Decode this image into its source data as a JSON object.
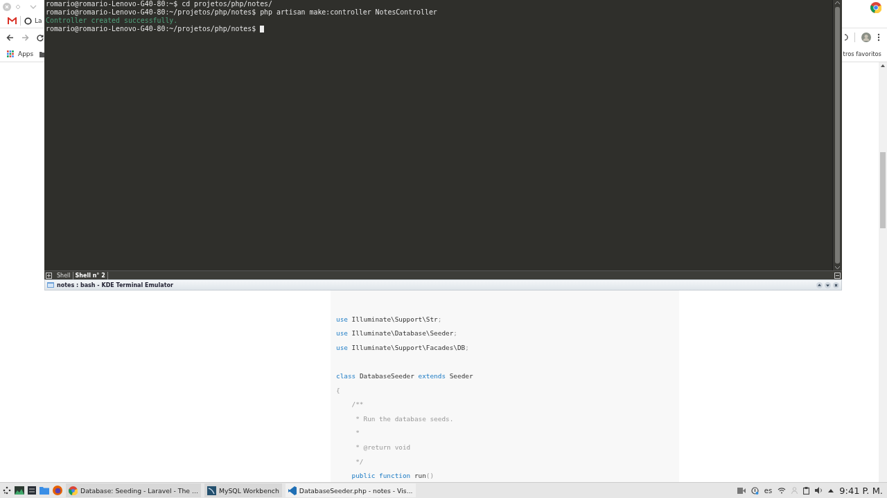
{
  "browser": {
    "tab_text": "La",
    "bookmarks": [
      {
        "label": "Apps"
      }
    ],
    "other_bookmarks": "tros favoritos",
    "code": [
      {
        "gap_before": true,
        "tokens": [
          {
            "text": "use",
            "kind": "kw"
          },
          {
            "text": " Illuminate\\Support\\Str",
            "kind": "plain"
          },
          {
            "text": ";",
            "kind": "punct"
          }
        ]
      },
      {
        "tokens": [
          {
            "text": "use",
            "kind": "kw"
          },
          {
            "text": " Illuminate\\Database\\Seeder",
            "kind": "plain"
          },
          {
            "text": ";",
            "kind": "punct"
          }
        ]
      },
      {
        "tokens": [
          {
            "text": "use",
            "kind": "kw"
          },
          {
            "text": " Illuminate\\Support\\Facades\\DB",
            "kind": "plain"
          },
          {
            "text": ";",
            "kind": "punct"
          }
        ]
      },
      {
        "gap_before": true,
        "tokens": [
          {
            "text": "class",
            "kind": "kw"
          },
          {
            "text": " DatabaseSeeder ",
            "kind": "plain"
          },
          {
            "text": "extends",
            "kind": "kw"
          },
          {
            "text": " Seeder",
            "kind": "plain"
          }
        ]
      },
      {
        "tokens": [
          {
            "text": "{",
            "kind": "punct"
          }
        ]
      },
      {
        "tokens": [
          {
            "text": "    /**",
            "kind": "comment"
          }
        ]
      },
      {
        "tokens": [
          {
            "text": "     * Run the database seeds.",
            "kind": "comment"
          }
        ]
      },
      {
        "tokens": [
          {
            "text": "     *",
            "kind": "comment"
          }
        ]
      },
      {
        "tokens": [
          {
            "text": "     * @return void",
            "kind": "comment"
          }
        ]
      },
      {
        "tokens": [
          {
            "text": "     */",
            "kind": "comment"
          }
        ]
      },
      {
        "tokens": [
          {
            "text": "    public function",
            "kind": "kw"
          },
          {
            "text": " run",
            "kind": "plain"
          },
          {
            "text": "()",
            "kind": "punct"
          }
        ]
      }
    ]
  },
  "terminal": {
    "lines": [
      {
        "text": "romario@romario-Lenovo-G40-80:~$ cd projetos/php/notes/",
        "kind": "prompt"
      },
      {
        "text": "romario@romario-Lenovo-G40-80:~/projetos/php/notes$ php artisan make:controller NotesController",
        "kind": "prompt"
      },
      {
        "text": "Controller created successfully.",
        "kind": "success"
      },
      {
        "text": "romario@romario-Lenovo-G40-80:~/projetos/php/notes$ ",
        "kind": "prompt",
        "cursor": true
      }
    ],
    "tabs": [
      {
        "label": "Shell",
        "selected": false
      },
      {
        "label": "Shell n° 2",
        "selected": true
      }
    ],
    "title": "notes : bash - KDE Terminal Emulator"
  },
  "taskbar": {
    "tasks": [
      {
        "label": "Database: Seeding - Laravel - The ...",
        "kind": "chrome"
      },
      {
        "label": "MySQL Workbench",
        "kind": "mysql"
      },
      {
        "label": "DatabaseSeeder.php - notes - Vis...",
        "kind": "vscode"
      }
    ],
    "language": "es",
    "clock": "9:41 P. M."
  }
}
